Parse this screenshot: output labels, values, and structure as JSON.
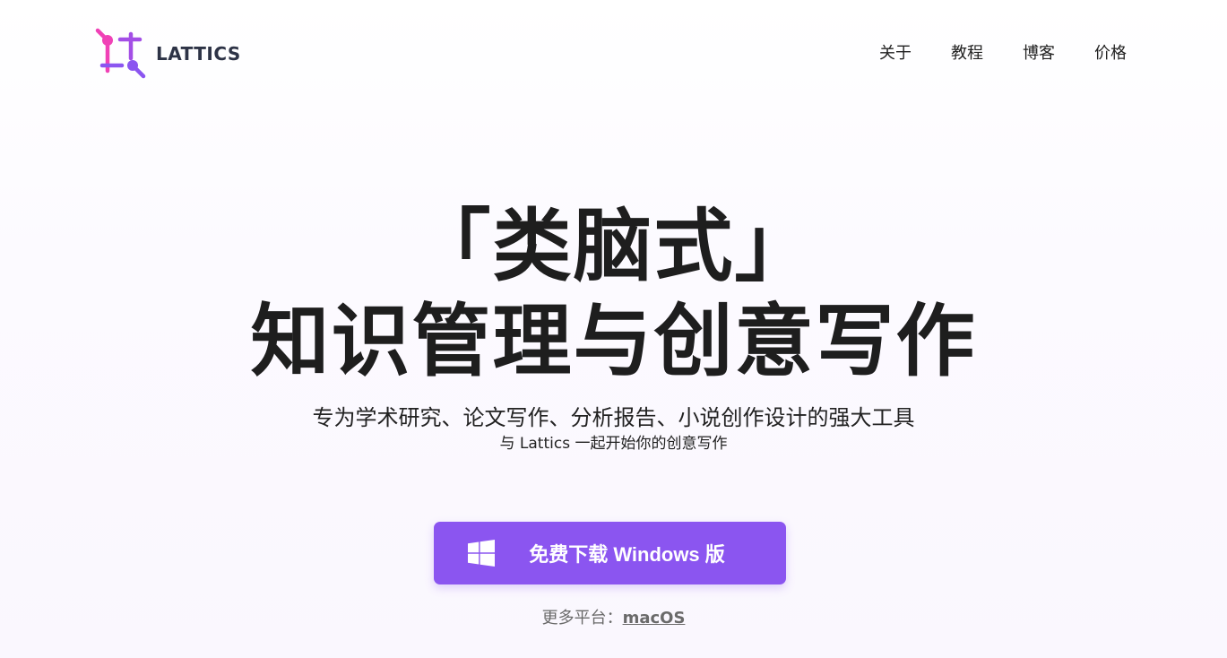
{
  "brand": {
    "name": "LATTICS",
    "colors": {
      "pink": "#f041b6",
      "purple": "#8b55f0",
      "text": "#2d3346"
    }
  },
  "nav": {
    "items": [
      {
        "label": "关于"
      },
      {
        "label": "教程"
      },
      {
        "label": "博客"
      },
      {
        "label": "价格"
      }
    ]
  },
  "hero": {
    "title_line1": "「类脑式」",
    "title_line2": "知识管理与创意写作",
    "subtitle": "专为学术研究、论文写作、分析报告、小说创作设计的强大工具",
    "tagline": "与 Lattics 一起开始你的创意写作"
  },
  "download": {
    "label": "免费下载 Windows 版",
    "icon": "windows-icon",
    "color": "#8b55f0"
  },
  "platforms": {
    "prefix": "更多平台：",
    "link": "macOS"
  }
}
